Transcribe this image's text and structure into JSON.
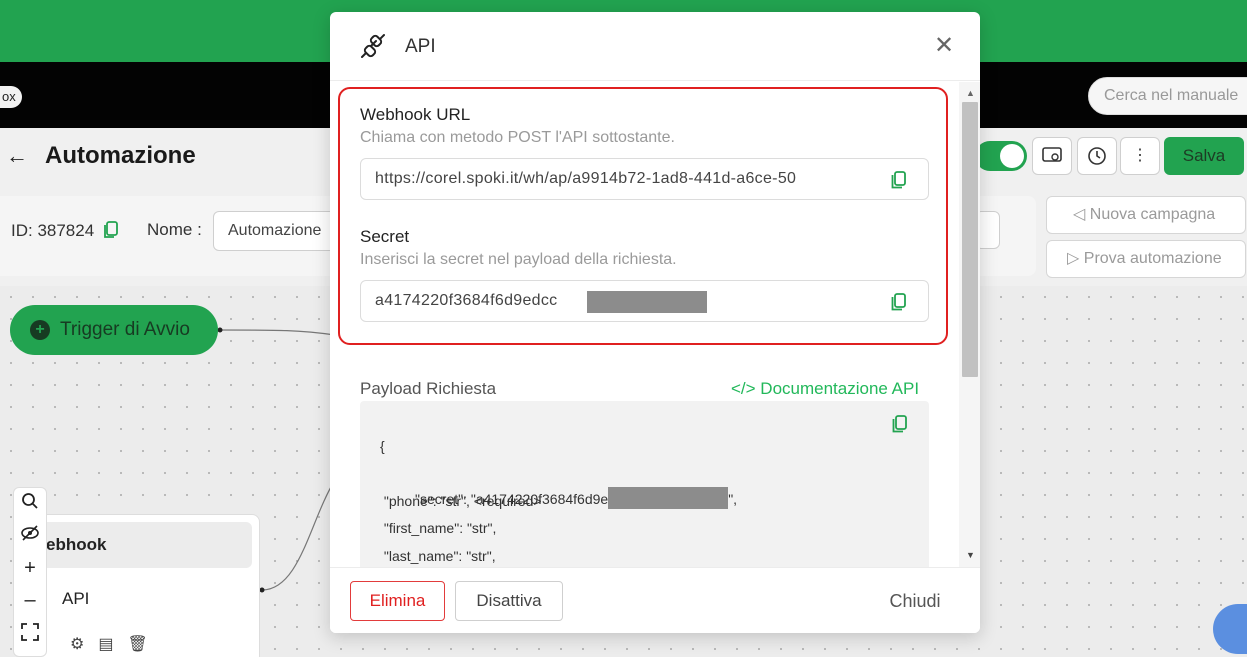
{
  "app": {
    "tab_pill": "ox",
    "search_placeholder": "Cerca nel manuale",
    "page_title": "Automazione",
    "save_label": "Salva",
    "id_label": "ID: 387824",
    "name_label": "Nome :",
    "name_value": "Automazione",
    "new_campaign_label": "Nuova campagna",
    "test_automation_label": "Prova automazione",
    "toggle_on": true
  },
  "canvas": {
    "trigger_label": "Trigger di Avvio",
    "node_title": "ebhook",
    "node_sub": "API"
  },
  "modal": {
    "title": "API",
    "webhook": {
      "label": "Webhook URL",
      "help": "Chiama con metodo POST l'API sottostante.",
      "value": "https://corel.spoki.it/wh/ap/a9914b72-1ad8-441d-a6ce-50"
    },
    "secret": {
      "label": "Secret",
      "help": "Inserisci la secret nel payload della richiesta.",
      "value": "a4174220f3684f6d9edcc"
    },
    "payload_label": "Payload Richiesta",
    "doc_link": "</> Documentazione API",
    "code": {
      "open": "{",
      "secret_prefix": " \"secret\": \"a4174220f3684f6d9e",
      "secret_suffix": "\",",
      "phone": " \"phone\": \"str\", <required>",
      "first_name": " \"first_name\": \"str\",",
      "last_name": " \"last_name\": \"str\","
    },
    "footer": {
      "delete": "Elimina",
      "disable": "Disattiva",
      "close": "Chiudi"
    }
  },
  "colors": {
    "brand_green": "#22a350",
    "link_green": "#22b85a",
    "danger_red": "#e02020"
  }
}
